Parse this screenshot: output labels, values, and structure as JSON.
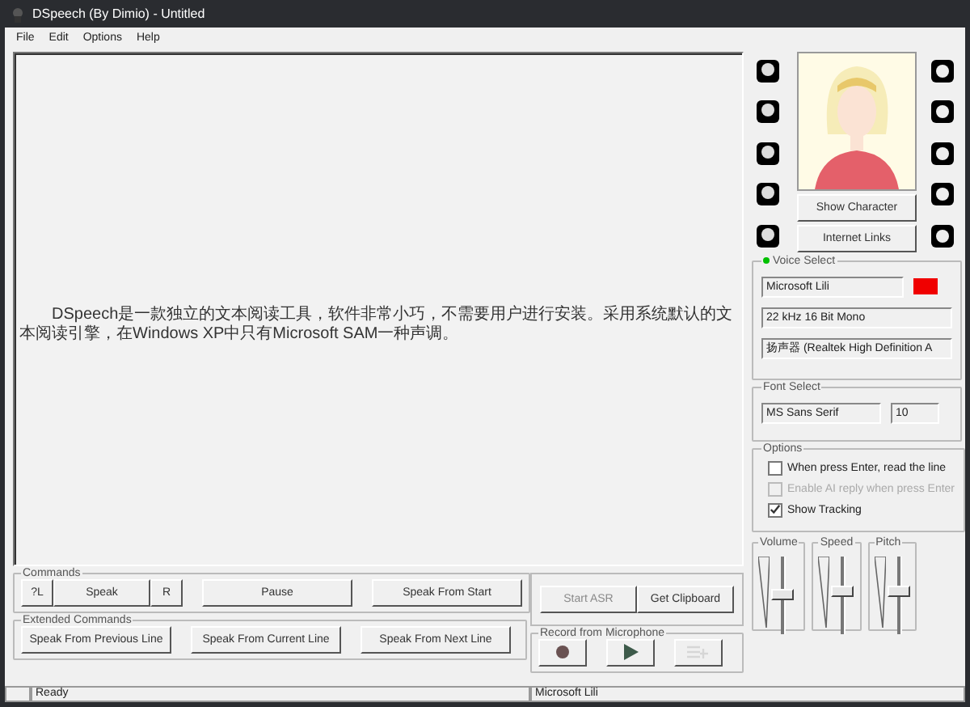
{
  "window": {
    "title": "DSpeech (By Dimio) - Untitled"
  },
  "menu": [
    "File",
    "Edit",
    "Options",
    "Help"
  ],
  "document": {
    "text": "DSpeech是一款独立的文本阅读工具，软件非常小巧，不需要用户进行安装。采用系统默认的文本阅读引擎，在Windows XP中只有Microsoft SAM一种声调。"
  },
  "character": {
    "buttons": [
      "Show Character",
      "Internet Links"
    ]
  },
  "voice_select": {
    "title": "Voice Select",
    "color": "#00c000",
    "fields": [
      "Microsoft Lili",
      "22 kHz 16 Bit Mono",
      "扬声器 (Realtek High Definition A"
    ]
  },
  "font_select": {
    "title": "Font Select",
    "font": "MS Sans Serif",
    "size": "10"
  },
  "options": {
    "title": "Options",
    "items": [
      {
        "label": "When press Enter, read the line",
        "checked": false,
        "disabled": false
      },
      {
        "label": "Enable AI reply when press Enter",
        "checked": false,
        "disabled": true
      },
      {
        "label": "Show Tracking",
        "checked": true,
        "disabled": false
      }
    ]
  },
  "commands": {
    "title": "Commands",
    "buttons": [
      "?L",
      "Speak",
      "R",
      "Pause",
      "Speak From Start"
    ]
  },
  "extended_commands": {
    "title": "Extended Commands",
    "buttons": [
      "Speak From Previous Line",
      "Speak From Current Line",
      "Speak From Next Line"
    ]
  },
  "asr": {
    "buttons": [
      {
        "label": "Start ASR",
        "disabled": true
      },
      {
        "label": "Get Clipboard",
        "disabled": false
      }
    ]
  },
  "record": {
    "title": "Record from Microphone",
    "buttons": [
      {
        "kind": "record",
        "disabled": false
      },
      {
        "kind": "play",
        "disabled": false
      },
      {
        "kind": "insert",
        "disabled": true
      }
    ]
  },
  "sliders": [
    {
      "label": "Volume",
      "level": 0.5
    },
    {
      "label": "Speed",
      "level": 0.55
    },
    {
      "label": "Pitch",
      "level": 0.55
    }
  ],
  "status_bar": [
    "Ready",
    "Microsoft Lili"
  ]
}
